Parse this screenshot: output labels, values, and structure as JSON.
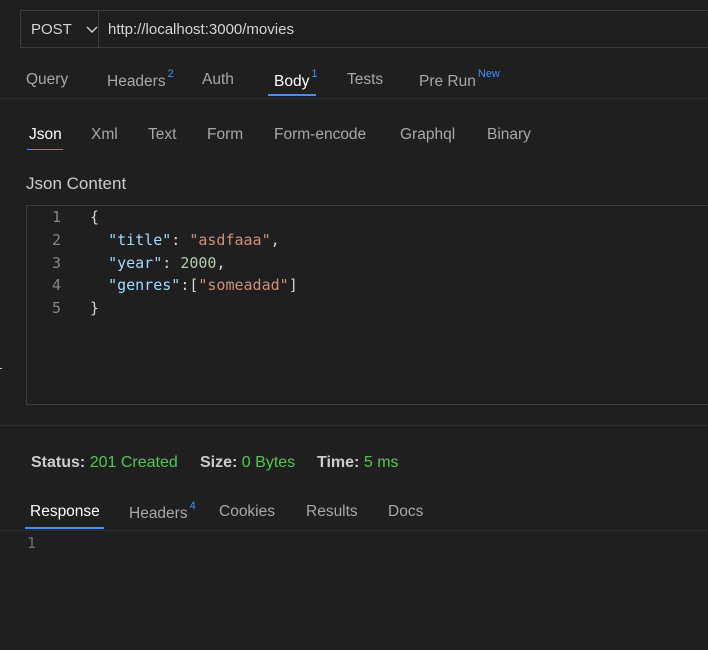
{
  "request": {
    "method": "POST",
    "url": "http://localhost:3000/movies"
  },
  "request_tabs": [
    {
      "label": "Query",
      "badge": ""
    },
    {
      "label": "Headers",
      "badge": "2"
    },
    {
      "label": "Auth",
      "badge": ""
    },
    {
      "label": "Body",
      "badge": "1"
    },
    {
      "label": "Tests",
      "badge": ""
    },
    {
      "label": "Pre Run",
      "badge": "New"
    }
  ],
  "body_tabs": [
    "Json",
    "Xml",
    "Text",
    "Form",
    "Form-encode",
    "Graphql",
    "Binary"
  ],
  "editor": {
    "title": "Json Content",
    "line_numbers": [
      "1",
      "2",
      "3",
      "4",
      "5"
    ],
    "lines": {
      "l1": "{",
      "l2_key": "\"title\"",
      "l2_sep": ": ",
      "l2_val": "\"asdfaaa\"",
      "l2_end": ",",
      "l3_key": "\"year\"",
      "l3_sep": ": ",
      "l3_val": "2000",
      "l3_end": ",",
      "l4_key": "\"genres\"",
      "l4_sep": ":[",
      "l4_val": "\"someadad\"",
      "l4_end": "]",
      "l5": "}"
    }
  },
  "response_status": {
    "status_label": "Status:",
    "status_value": "201 Created",
    "size_label": "Size:",
    "size_value": "0 Bytes",
    "time_label": "Time:",
    "time_value": "5 ms"
  },
  "response_tabs": [
    {
      "label": "Response",
      "badge": ""
    },
    {
      "label": "Headers",
      "badge": "4"
    },
    {
      "label": "Cookies",
      "badge": ""
    },
    {
      "label": "Results",
      "badge": ""
    },
    {
      "label": "Docs",
      "badge": ""
    }
  ],
  "response_body": {
    "line_numbers": [
      "1"
    ]
  },
  "colors": {
    "accent": "#3794ff",
    "status_ok": "#4ec94e",
    "background": "#1f1f1f"
  },
  "icons": {
    "method_dropdown": "chevron-down-icon"
  }
}
